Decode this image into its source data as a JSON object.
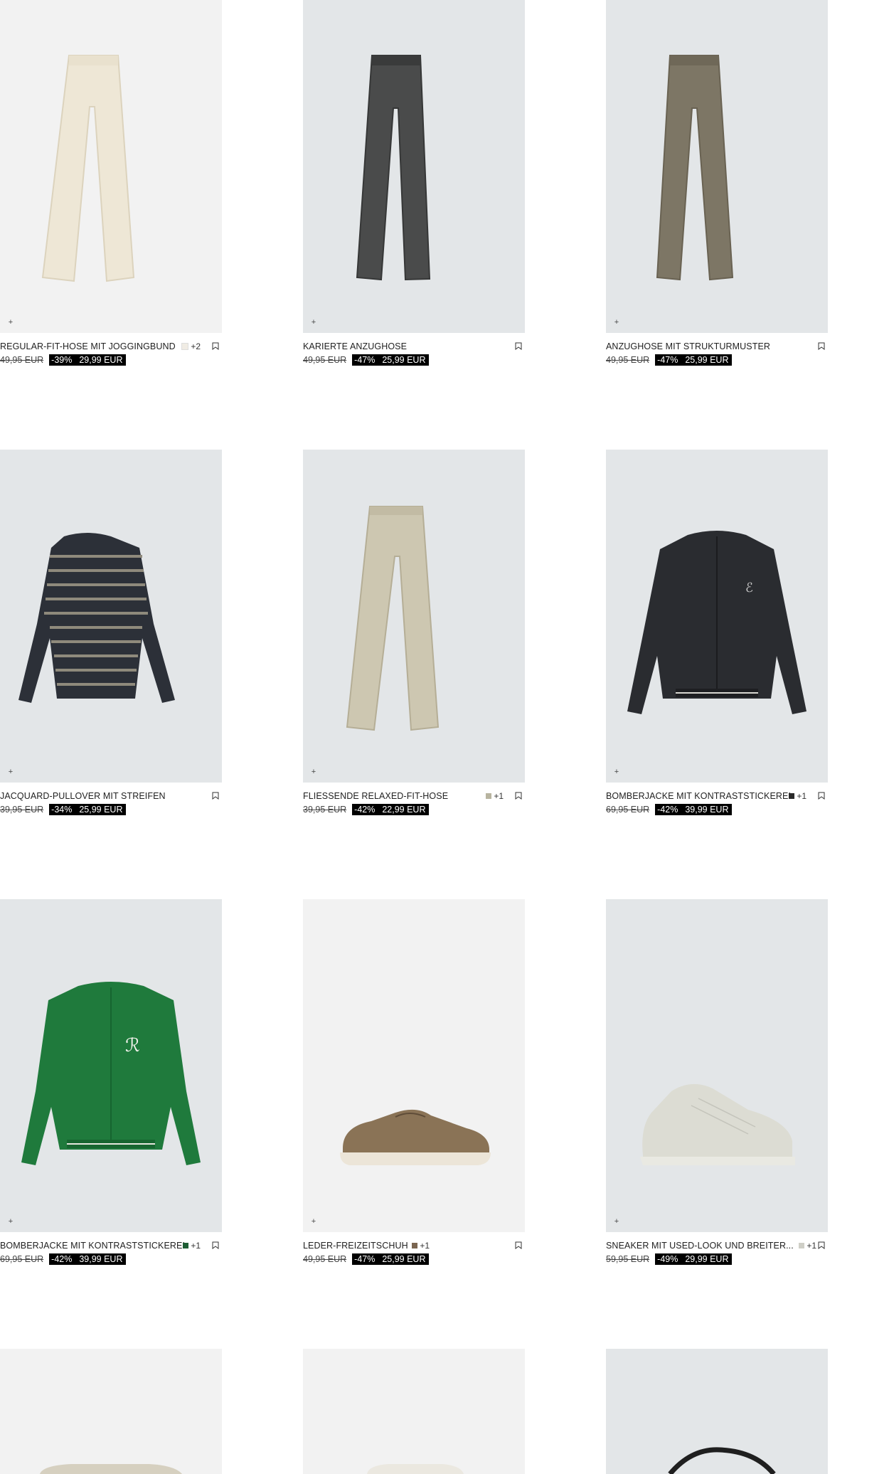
{
  "products": [
    {
      "name": "REGULAR-FIT-HOSE MIT JOGGINGBUND",
      "old_price": "49,95 EUR",
      "discount": "-39%",
      "price": "29,99 EUR",
      "more_colors": "+2",
      "swatch_color": "#f0ece4",
      "item": "trousers-cream"
    },
    {
      "name": "KARIERTE ANZUGHOSE",
      "old_price": "49,95 EUR",
      "discount": "-47%",
      "price": "25,99 EUR",
      "more_colors": "",
      "swatch_color": "",
      "item": "trousers-checked"
    },
    {
      "name": "ANZUGHOSE MIT STRUKTURMUSTER",
      "old_price": "49,95 EUR",
      "discount": "-47%",
      "price": "25,99 EUR",
      "more_colors": "",
      "swatch_color": "",
      "item": "trousers-olive"
    },
    {
      "name": "JACQUARD-PULLOVER MIT STREIFEN",
      "old_price": "39,95 EUR",
      "discount": "-34%",
      "price": "25,99 EUR",
      "more_colors": "",
      "swatch_color": "",
      "item": "striped-sweater"
    },
    {
      "name": "FLIESSENDE RELAXED-FIT-HOSE",
      "old_price": "39,95 EUR",
      "discount": "-42%",
      "price": "22,99 EUR",
      "more_colors": "+1",
      "swatch_color": "#b8b4a0",
      "item": "trousers-beige"
    },
    {
      "name": "BOMBERJACKE MIT KONTRASTSTICKEREI",
      "old_price": "69,95 EUR",
      "discount": "-42%",
      "price": "39,99 EUR",
      "more_colors": "+1",
      "swatch_color": "#2a2a2a",
      "item": "bomber-black"
    },
    {
      "name": "BOMBERJACKE MIT KONTRASTSTICKEREI",
      "old_price": "69,95 EUR",
      "discount": "-42%",
      "price": "39,99 EUR",
      "more_colors": "+1",
      "swatch_color": "#1e5e35",
      "item": "bomber-green"
    },
    {
      "name": "LEDER-FREIZEITSCHUH",
      "old_price": "49,95 EUR",
      "discount": "-47%",
      "price": "25,99 EUR",
      "more_colors": "+1",
      "swatch_color": "#7a6550",
      "item": "loafer-brown"
    },
    {
      "name": "SNEAKER MIT USED-LOOK UND BREITER...",
      "old_price": "59,95 EUR",
      "discount": "-49%",
      "price": "29,99 EUR",
      "more_colors": "+1",
      "swatch_color": "#cfcfc7",
      "item": "sneaker-white"
    }
  ],
  "partial_row": [
    "shorts-light",
    "shorts-white",
    "bag-black"
  ]
}
